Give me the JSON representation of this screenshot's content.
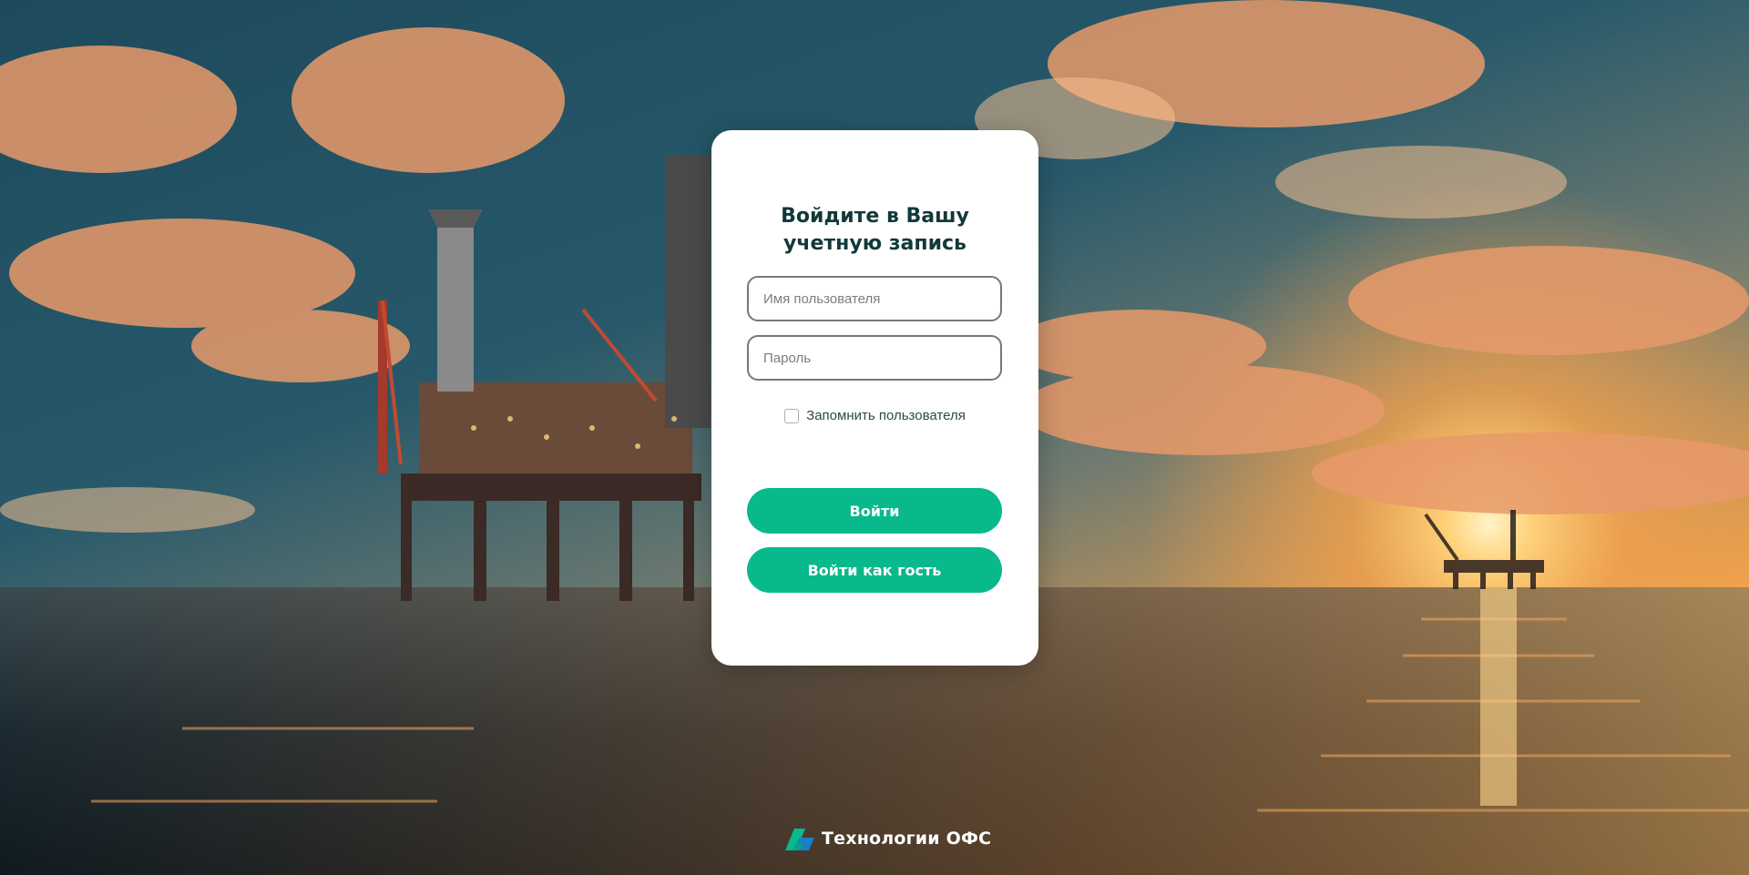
{
  "login": {
    "title_line1": "Войдите в Вашу",
    "title_line2": "учетную запись",
    "username_placeholder": "Имя пользователя",
    "username_value": "",
    "password_placeholder": "Пароль",
    "password_value": "",
    "remember_label": "Запомнить пользователя",
    "remember_checked": false,
    "login_button": "Войти",
    "guest_button": "Войти как гость"
  },
  "brand": {
    "name": "Технологии ОФС",
    "logo_icon": "ofs-logo-icon"
  },
  "background": {
    "scene": "offshore-oil-platform-sunset"
  },
  "colors": {
    "accent": "#08b98c",
    "title": "#11393a",
    "card": "#ffffff"
  }
}
